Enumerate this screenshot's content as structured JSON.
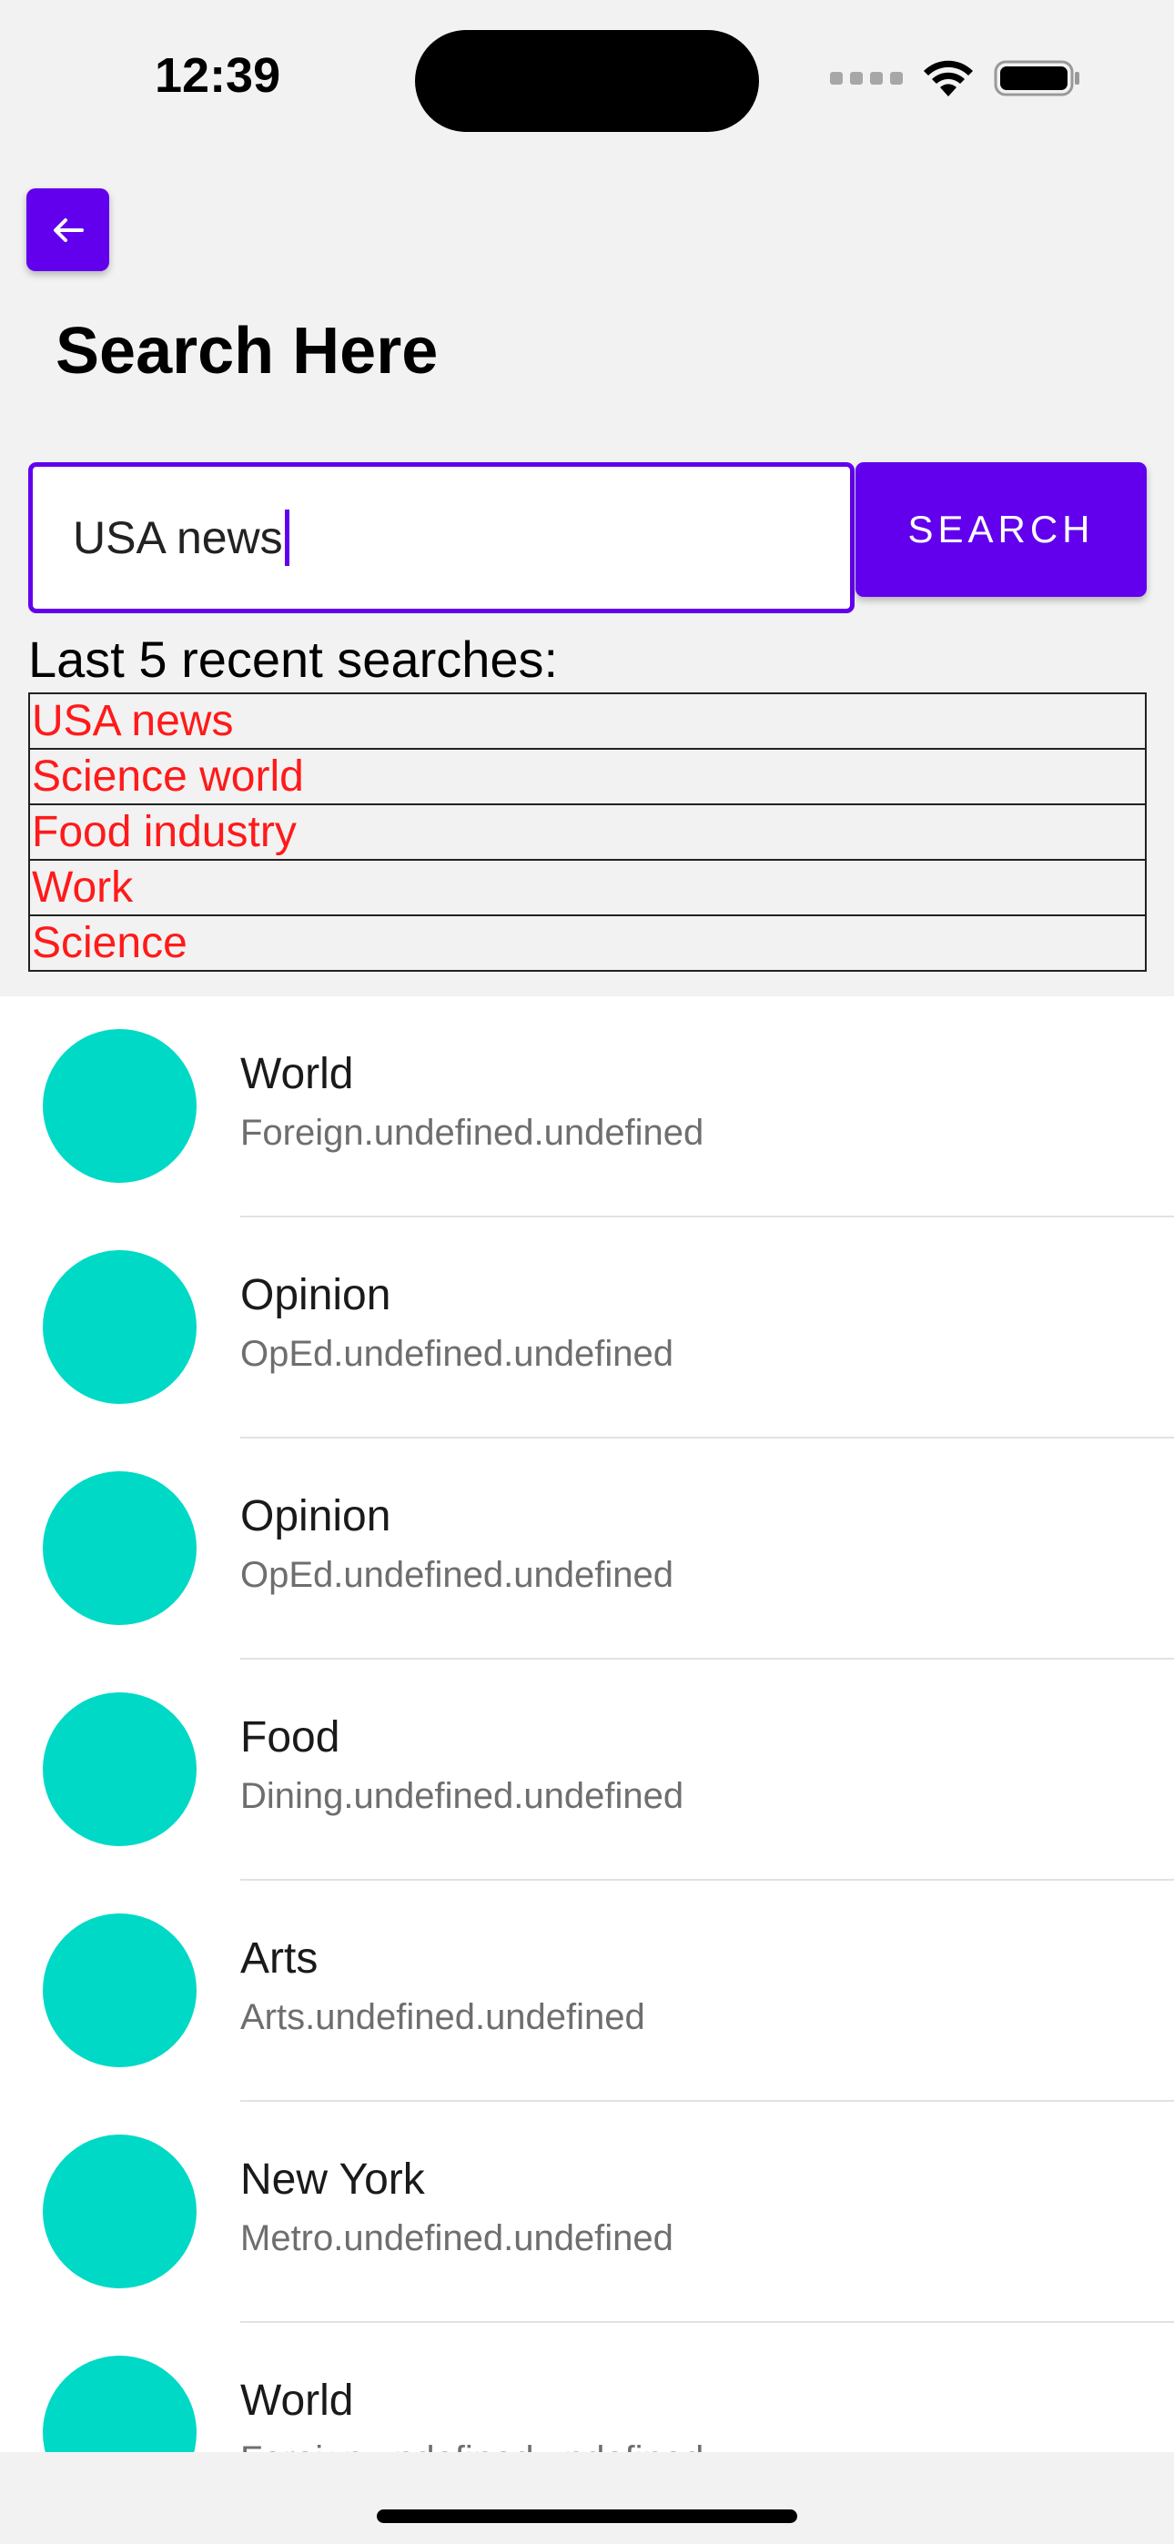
{
  "status_bar": {
    "time": "12:39"
  },
  "header": {
    "title": "Search Here"
  },
  "search": {
    "value": "USA news",
    "button_label": "SEARCH"
  },
  "recent": {
    "heading": "Last 5 recent searches:",
    "items": [
      "USA news",
      "Science world",
      "Food industry",
      "Work",
      "Science"
    ]
  },
  "results": [
    {
      "title": "World",
      "subtitle": "Foreign.undefined.undefined"
    },
    {
      "title": "Opinion",
      "subtitle": "OpEd.undefined.undefined"
    },
    {
      "title": "Opinion",
      "subtitle": "OpEd.undefined.undefined"
    },
    {
      "title": "Food",
      "subtitle": "Dining.undefined.undefined"
    },
    {
      "title": "Arts",
      "subtitle": "Arts.undefined.undefined"
    },
    {
      "title": "New York",
      "subtitle": "Metro.undefined.undefined"
    },
    {
      "title": "World",
      "subtitle": "Foreign.undefined.undefined"
    }
  ],
  "colors": {
    "accent": "#6200ee",
    "avatar": "#00d9c6",
    "recent_text": "#ff1a1a"
  },
  "icons": {
    "back": "arrow-left-icon",
    "wifi": "wifi-icon",
    "battery": "battery-icon",
    "signal": "cellular-signal-icon"
  }
}
